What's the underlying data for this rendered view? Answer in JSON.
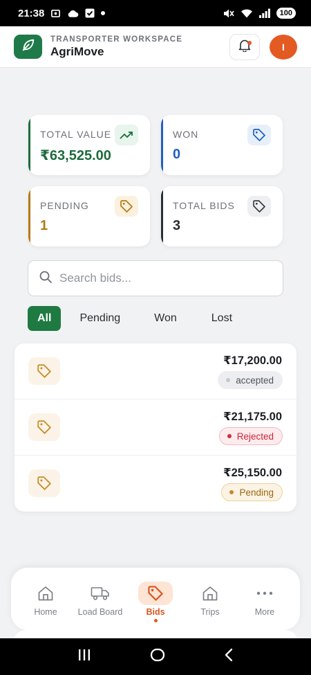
{
  "status_bar": {
    "time": "21:38",
    "battery": "100"
  },
  "header": {
    "kicker": "TRANSPORTER WORKSPACE",
    "app_name": "AgriMove",
    "avatar_initial": "I"
  },
  "stats": [
    {
      "label": "TOTAL VALUE",
      "value": "₹63,525.00",
      "icon": "trend-up-icon",
      "accent": "#1d6b3d",
      "tint": "#e7f5ec"
    },
    {
      "label": "WON",
      "value": "0",
      "icon": "tag-icon",
      "accent": "#1f5fc2",
      "tint": "#e7effb"
    },
    {
      "label": "PENDING",
      "value": "1",
      "icon": "tag-icon",
      "accent": "#b57a14",
      "tint": "#fbf1de"
    },
    {
      "label": "TOTAL BIDS",
      "value": "3",
      "icon": "tag-icon",
      "accent": "#2a2d31",
      "tint": "#eeeff1"
    }
  ],
  "search": {
    "placeholder": "Search bids...",
    "value": ""
  },
  "filters": [
    "All",
    "Pending",
    "Won",
    "Lost"
  ],
  "active_filter": "All",
  "bids": [
    {
      "amount": "₹17,200.00",
      "status": "accepted"
    },
    {
      "amount": "₹21,175.00",
      "status": "Rejected"
    },
    {
      "amount": "₹25,150.00",
      "status": "Pending"
    }
  ],
  "bottom_nav": [
    {
      "label": "Home",
      "icon": "home-icon"
    },
    {
      "label": "Load Board",
      "icon": "truck-icon"
    },
    {
      "label": "Bids",
      "icon": "tag-icon",
      "active": true
    },
    {
      "label": "Trips",
      "icon": "trips-icon"
    },
    {
      "label": "More",
      "icon": "more-icon"
    }
  ],
  "colors": {
    "brand_green": "#1f7a42",
    "accent_orange": "#e35a23",
    "background": "#f1f2f4"
  }
}
